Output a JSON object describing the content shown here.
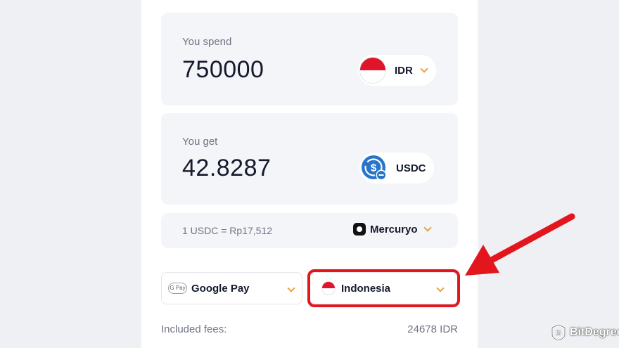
{
  "spend": {
    "label": "You spend",
    "amount": "750000",
    "currency": "IDR",
    "flag_icon": "indonesia-flag-icon"
  },
  "get": {
    "label": "You get",
    "amount": "42.8287",
    "currency": "USDC",
    "icon": "usdc-coin-icon"
  },
  "rate": {
    "text": "1 USDC = Rp17,512",
    "provider": "Mercuryo"
  },
  "payment": {
    "badge": "G Pay",
    "method": "Google Pay"
  },
  "country": {
    "name": "Indonesia"
  },
  "fees": {
    "label": "Included fees:",
    "value": "24678 IDR"
  },
  "watermark": {
    "text": "BitDegree"
  },
  "colors": {
    "background": "#eef0f4",
    "card": "#f4f5f8",
    "accent_chevron": "#e9a23a",
    "highlight_red": "#e3161e",
    "usdc_blue": "#2775ca"
  }
}
